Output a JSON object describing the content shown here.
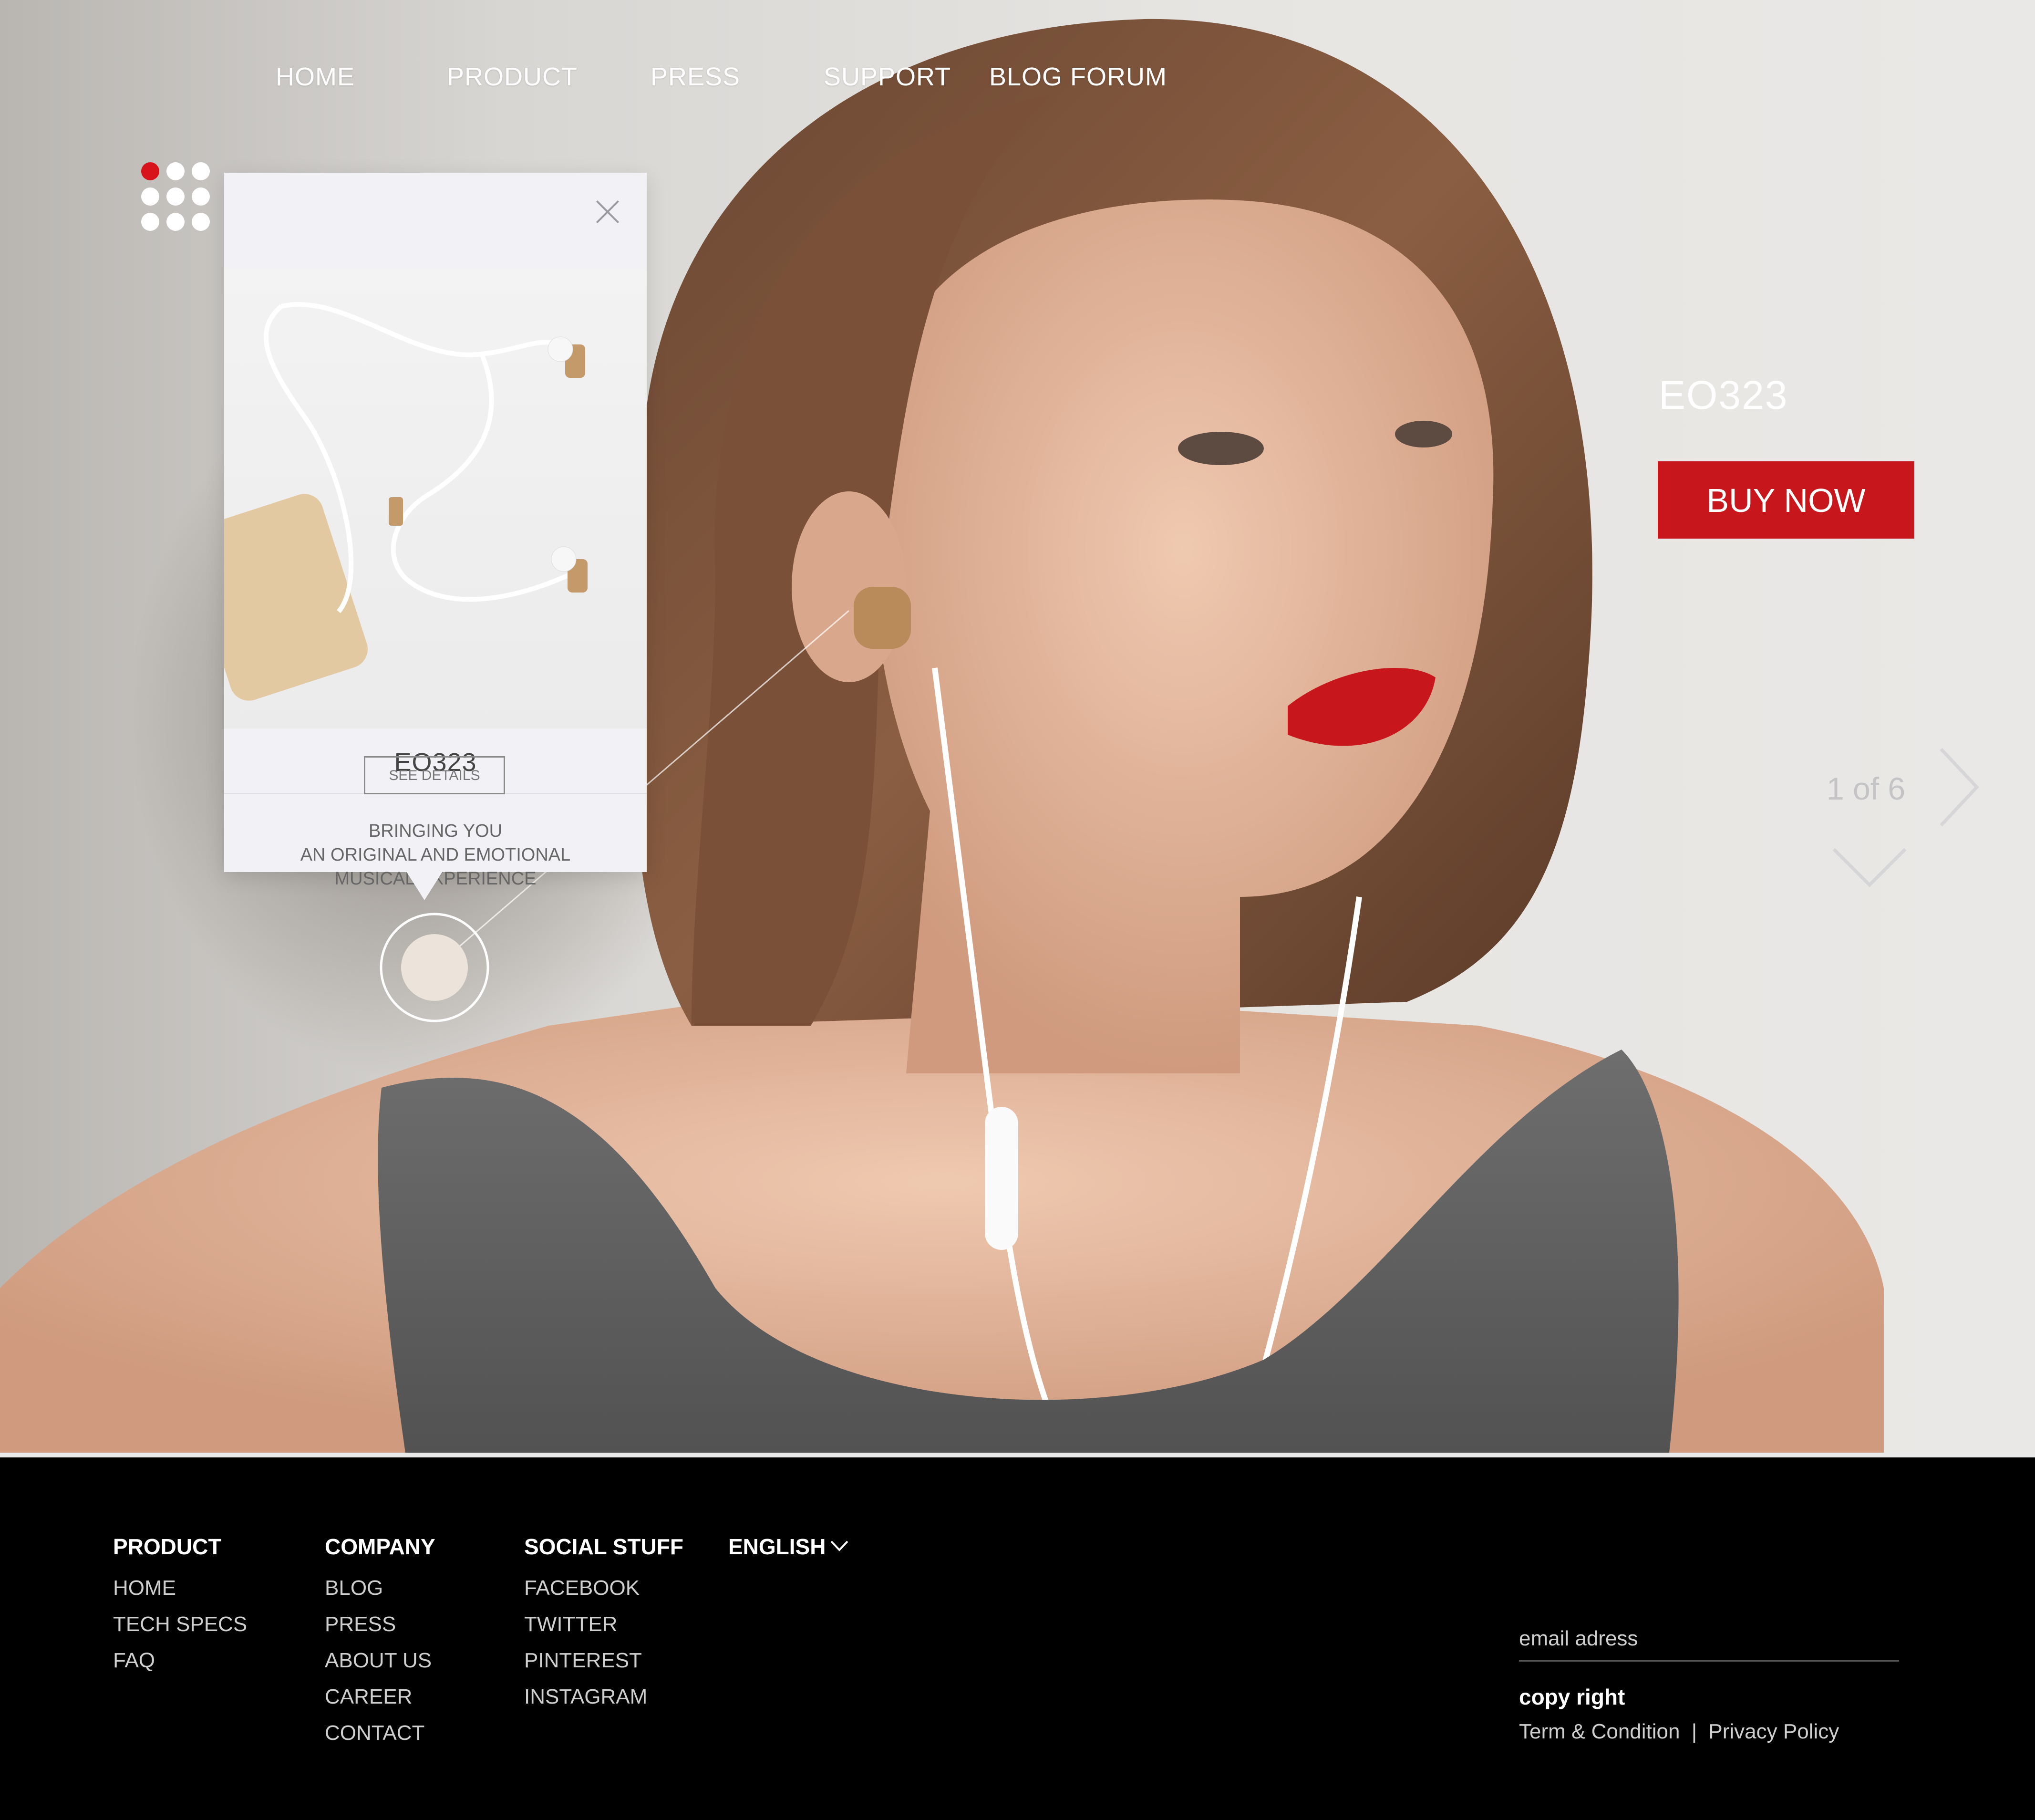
{
  "nav": {
    "items": [
      {
        "label": "HOME"
      },
      {
        "label": "PRODUCT"
      },
      {
        "label": "PRESS"
      },
      {
        "label": "SUPPORT"
      },
      {
        "label": "BLOG FORUM"
      }
    ]
  },
  "popup": {
    "title": "EO323",
    "description_lines": [
      "BRINGING YOU",
      "AN ORIGINAL AND EMOTIONAL",
      "MUSICAL EXPERIENCE"
    ],
    "button_label": "SEE DETAILS"
  },
  "hero": {
    "product_name": "EO323",
    "buy_label": "BUY NOW",
    "pager": "1 of 6"
  },
  "footer": {
    "columns": [
      {
        "heading": "PRODUCT",
        "links": [
          "HOME",
          "TECH SPECS",
          "FAQ"
        ]
      },
      {
        "heading": "COMPANY",
        "links": [
          "BLOG",
          "PRESS",
          "ABOUT US",
          "CAREER",
          "CONTACT"
        ]
      },
      {
        "heading": "SOCIAL STUFF",
        "links": [
          "FACEBOOK",
          "TWITTER",
          "PINTEREST",
          "INSTAGRAM"
        ]
      }
    ],
    "language": "ENGLISH",
    "email_placeholder": "email adress",
    "copyright": "copy right",
    "terms": "Term & Condition",
    "separator": "|",
    "privacy": "Privacy Policy"
  },
  "colors": {
    "accent": "#c8161d",
    "footer_bg": "#000000",
    "active_dot": "#d7141c"
  },
  "icons": {
    "menu": "grid-dots-icon",
    "close": "close-icon",
    "next": "chevron-right-icon",
    "down": "chevron-down-icon",
    "language": "chevron-down-icon"
  }
}
